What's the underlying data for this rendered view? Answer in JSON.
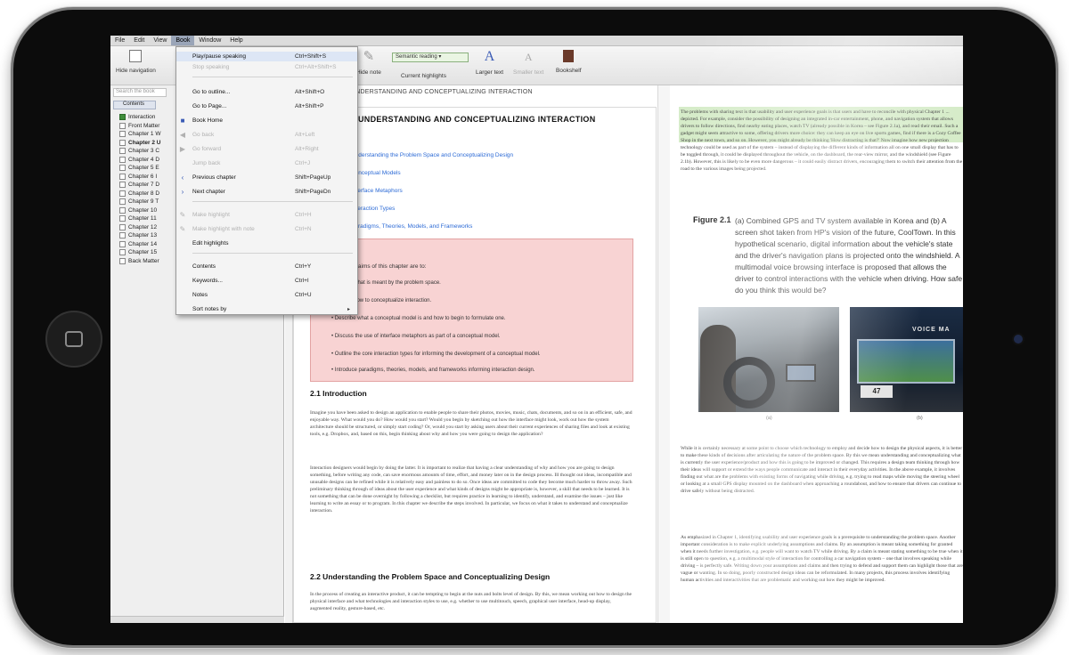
{
  "menubar": {
    "items": [
      "File",
      "Edit",
      "View",
      "Book",
      "Window",
      "Help"
    ],
    "active": "Book"
  },
  "toolbar": {
    "hide_navigation": "Hide navigation",
    "hide_note": "Hide note",
    "semantic_reading": "Semantic reading",
    "current_highlights": "Current highlights",
    "larger_text": "Larger text",
    "smaller_text": "Smaller text",
    "bookshelf": "Bookshelf"
  },
  "breadcrumb": "UNDERSTANDING AND CONCEPTUALIZING INTERACTION",
  "sidebar": {
    "search_placeholder": "Search the book",
    "tab_contents": "Contents",
    "items": [
      {
        "label": "Interaction",
        "checked": true,
        "bold": false
      },
      {
        "label": "Front Matter",
        "checked": false,
        "bold": false
      },
      {
        "label": "Chapter 1 W",
        "checked": false,
        "bold": false
      },
      {
        "label": "Chapter 2 U",
        "checked": false,
        "bold": true
      },
      {
        "label": "Chapter 3 C",
        "checked": false,
        "bold": false
      },
      {
        "label": "Chapter 4 D",
        "checked": false,
        "bold": false
      },
      {
        "label": "Chapter 5 E",
        "checked": false,
        "bold": false
      },
      {
        "label": "Chapter 6 I",
        "checked": false,
        "bold": false
      },
      {
        "label": "Chapter 7 D",
        "checked": false,
        "bold": false
      },
      {
        "label": "Chapter 8 D",
        "checked": false,
        "bold": false
      },
      {
        "label": "Chapter 9 T",
        "checked": false,
        "bold": false
      },
      {
        "label": "Chapter 10",
        "checked": false,
        "bold": false
      },
      {
        "label": "Chapter 11",
        "checked": false,
        "bold": false
      },
      {
        "label": "Chapter 12",
        "checked": false,
        "bold": false
      },
      {
        "label": "Chapter 13",
        "checked": false,
        "bold": false
      },
      {
        "label": "Chapter 14",
        "checked": false,
        "bold": false
      },
      {
        "label": "Chapter 15",
        "checked": false,
        "bold": false
      },
      {
        "label": "Back Matter",
        "checked": false,
        "bold": false
      }
    ]
  },
  "book_menu": [
    {
      "label": "Play/pause speaking",
      "shortcut": "Ctrl+Shift+S",
      "disabled": false,
      "icon": ""
    },
    {
      "label": "Stop speaking",
      "shortcut": "Ctrl+Alt+Shift+S",
      "disabled": true,
      "icon": ""
    },
    {
      "label": "Go to outline...",
      "shortcut": "Alt+Shift+O",
      "disabled": false,
      "icon": ""
    },
    {
      "label": "Go to Page...",
      "shortcut": "Alt+Shift+P",
      "disabled": false,
      "icon": ""
    },
    {
      "label": "Book Home",
      "shortcut": "",
      "disabled": false,
      "icon": "home"
    },
    {
      "label": "Go back",
      "shortcut": "Alt+Left",
      "disabled": true,
      "icon": "back"
    },
    {
      "label": "Go forward",
      "shortcut": "Alt+Right",
      "disabled": true,
      "icon": "forward"
    },
    {
      "label": "Jump back",
      "shortcut": "Ctrl+J",
      "disabled": true,
      "icon": ""
    },
    {
      "label": "Previous chapter",
      "shortcut": "Shift+PageUp",
      "disabled": false,
      "icon": "prev"
    },
    {
      "label": "Next chapter",
      "shortcut": "Shift+PageDn",
      "disabled": false,
      "icon": "next"
    },
    {
      "label": "Make highlight",
      "shortcut": "Ctrl+H",
      "disabled": true,
      "icon": "pen"
    },
    {
      "label": "Make highlight with note",
      "shortcut": "Ctrl+N",
      "disabled": true,
      "icon": "pen"
    },
    {
      "label": "Edit highlights",
      "shortcut": "",
      "disabled": false,
      "icon": ""
    },
    {
      "label": "Contents",
      "shortcut": "Ctrl+Y",
      "disabled": false,
      "icon": ""
    },
    {
      "label": "Keywords...",
      "shortcut": "Ctrl+I",
      "disabled": false,
      "icon": ""
    },
    {
      "label": "Notes",
      "shortcut": "Ctrl+U",
      "disabled": false,
      "icon": ""
    },
    {
      "label": "Sort notes by",
      "shortcut": "",
      "disabled": false,
      "icon": "",
      "submenu": true
    }
  ],
  "left_page": {
    "chapter_title": "UNDERSTANDING AND CONCEPTUALIZING INTERACTION",
    "toc": [
      "Understanding the Problem Space and Conceptualizing Design",
      "Conceptual Models",
      "Interface Metaphors",
      "Interaction Types",
      "Paradigms, Theories, Models, and Frameworks"
    ],
    "objectives_intro": "The main aims of this chapter are to:",
    "objectives": [
      "Explain what is meant by the problem space.",
      "Explain how to conceptualize interaction.",
      "Describe what a conceptual model is and how to begin to formulate one.",
      "Discuss the use of interface metaphors as part of a conceptual model.",
      "Outline the core interaction types for informing the development of a conceptual model.",
      "Introduce paradigms, theories, models, and frameworks informing interaction design."
    ],
    "section_1": "2.1 Introduction",
    "para_1": "Imagine you have been asked to design an application to enable people to share their photos, movies, music, chats, documents, and so on in an efficient, safe, and enjoyable way. What would you do? How would you start? Would you begin by sketching out how the interface might look, work out how the system architecture should be structured, or simply start coding? Or, would you start by asking users about their current experiences of sharing files and look at existing tools, e.g. Dropbox, and, based on this, begin thinking about why and how you were going to design the application?",
    "para_2": "Interaction designers would begin by doing the latter. It is important to realize that having a clear understanding of why and how you are going to design something, before writing any code, can save enormous amounts of time, effort, and money later on in the design process. Ill thought out ideas, incompatible and unusable designs can be refined while it is relatively easy and painless to do so. Once ideas are committed to code they become much harder to throw away. Such preliminary thinking through of ideas about the user experience and what kinds of designs might be appropriate is, however, a skill that needs to be learned. It is not something that can be done overnight by following a checklist, but requires practice in learning to identify, understand, and examine the issues – just like learning to write an essay or to program. In this chapter we describe the steps involved. In particular, we focus on what it takes to understand and conceptualize interaction.",
    "section_2": "2.2 Understanding the Problem Space and Conceptualizing Design",
    "para_3": "In the process of creating an interactive product, it can be tempting to begin at the nuts and bolts level of design. By this, we mean working out how to design the physical interface and what technologies and interaction styles to use, e.g. whether to use multitouch, speech, graphical user interface, head-up display, augmented reality, gesture-based, etc."
  },
  "right_page": {
    "para_top": "The problems with sharing text is that usability and user experience goals is that users and have to reconcile with physical Chapter 1 ... depicted. For example, consider the possibility of designing an integrated in-car entertainment, phone, and navigation system that allows drivers to follow directions, find nearby eating places, watch TV (already possible in Korea – see Figure 2.1a), and read their email. Such a gadget might seem attractive to some, offering drivers more choice: they can keep an eye on live sports games, find if there is a Cozy Coffee Shop in the next town, and so on. However, you might already be thinking 'How distracting is that?' Now imagine how new projection technology could be used as part of the system – instead of displaying the different kinds of information all on one small display that has to be toggled through, it could be displayed throughout the vehicle, on the dashboard, the rear-view mirror, and the windshield (see Figure 2.1b). However, this is likely to be even more dangerous – it could easily distract drivers, encouraging them to switch their attention from the road to the various images being projected.",
    "figure_label": "Figure 2.1",
    "figure_caption": "(a) Combined GPS and TV system available in Korea and (b) A screen shot taken from HP's vision of the future, CoolTown. In this hypothetical scenario, digital information about the vehicle's state and the driver's navigation plans is projected onto the windshield. A multimodal voice browsing interface is proposed that allows the driver to control interactions with the vehicle when driving. How safe do you think this would be?",
    "photo_a_label": "(a)",
    "photo_b_label": "(b)",
    "photo_b_overlay": "VOICE MA",
    "photo_b_number": "47",
    "para_mid": "While it is certainly necessary at some point to choose which technology to employ and decide how to design the physical aspects, it is better to make these kinds of decisions after articulating the nature of the problem space. By this we mean understanding and conceptualizing what is currently the user experience/product and how this is going to be improved or changed. This requires a design team thinking through how their ideas will support or extend the ways people communicate and interact in their everyday activities. In the above example, it involves finding out what are the problems with existing forms of navigating while driving, e.g. trying to read maps while moving the steering wheel or looking at a small GPS display mounted on the dashboard when approaching a roundabout, and how to ensure that drivers can continue to drive safely without being distracted.",
    "para_bottom": "As emphasized in Chapter 1, identifying usability and user experience goals is a prerequisite to understanding the problem space. Another important consideration is to make explicit underlying assumptions and claims. By an assumption is meant taking something for granted when it needs further investigation, e.g. people will want to watch TV while driving. By a claim is meant stating something to be true when it is still open to question, e.g. a multimodal style of interaction for controlling a car navigation system – one that involves speaking while driving – is perfectly safe. Writing down your assumptions and claims and then trying to defend and support them can highlight those that are vague or wanting. In so doing, poorly constructed design ideas can be reformulated. In many projects, this process involves identifying human activities and interactivities that are problematic and working out how they might be improved."
  },
  "colors": {
    "highlight_green": "#d6ecc9",
    "objectives_pink": "#f8d3d3",
    "link_blue": "#2d6bd6"
  }
}
